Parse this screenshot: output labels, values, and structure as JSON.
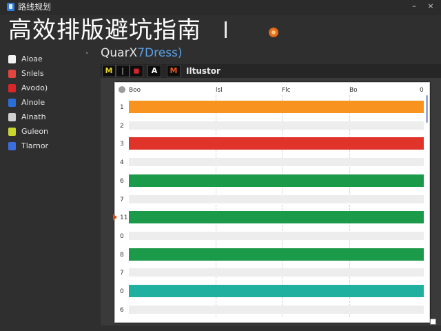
{
  "window": {
    "title": "路线规划",
    "minimize_glyph": "–",
    "close_glyph": "×"
  },
  "banner": {
    "title": "高效排版避坑指南"
  },
  "sidebar": {
    "collapse_glyph": "˅",
    "items": [
      {
        "label": "Aloae",
        "icon": "cup-icon",
        "color": "#f2f2f2"
      },
      {
        "label": "Snlels",
        "icon": "red-box-icon",
        "color": "#e2463f"
      },
      {
        "label": "Avodo)",
        "icon": "red-flag-icon",
        "color": "#d9262a"
      },
      {
        "label": "Alnole",
        "icon": "blue-square-icon",
        "color": "#2a6fd9"
      },
      {
        "label": "Alnath",
        "icon": "document-icon",
        "color": "#cfcfcf"
      },
      {
        "label": "Guleon",
        "icon": "yellow-green-square-icon",
        "color": "#c8d62e"
      },
      {
        "label": "Tlarnor",
        "icon": "image-icon",
        "color": "#3b6fe0"
      }
    ]
  },
  "subheader": {
    "text_main": "QuarX",
    "text_accent": "7Dress)"
  },
  "toolbar": {
    "buttons": [
      {
        "glyph": "M",
        "color": "#e8d22a",
        "name": "yellow-m-tool-button"
      },
      {
        "glyph": "|",
        "color": "#9a9a9a",
        "name": "bar-tool-button"
      },
      {
        "glyph": "◼",
        "color": "#d9262a",
        "name": "red-tool-button"
      },
      {
        "glyph": "A",
        "color": "#ffffff",
        "name": "text-tool-button"
      },
      {
        "glyph": "M",
        "color": "#e8531c",
        "name": "orange-m-tool-button"
      }
    ],
    "label": "Iltustor"
  },
  "grid": {
    "corner_label": "Boo",
    "columns": [
      "lsl",
      "Flc",
      "Bo",
      "0"
    ],
    "rows": [
      "1",
      "2",
      "3",
      "4",
      "6",
      "7",
      "11",
      "0",
      "8",
      "7",
      "0",
      "6"
    ],
    "bars": [
      {
        "row": 0,
        "color": "#f7931e"
      },
      {
        "row": 2,
        "color": "#e0342a"
      },
      {
        "row": 4,
        "color": "#1b9a4a"
      },
      {
        "row": 6,
        "color": "#1b9a4a"
      },
      {
        "row": 8,
        "color": "#1b9a4a"
      },
      {
        "row": 10,
        "color": "#1fb0a0"
      }
    ],
    "marker_row": 6
  }
}
